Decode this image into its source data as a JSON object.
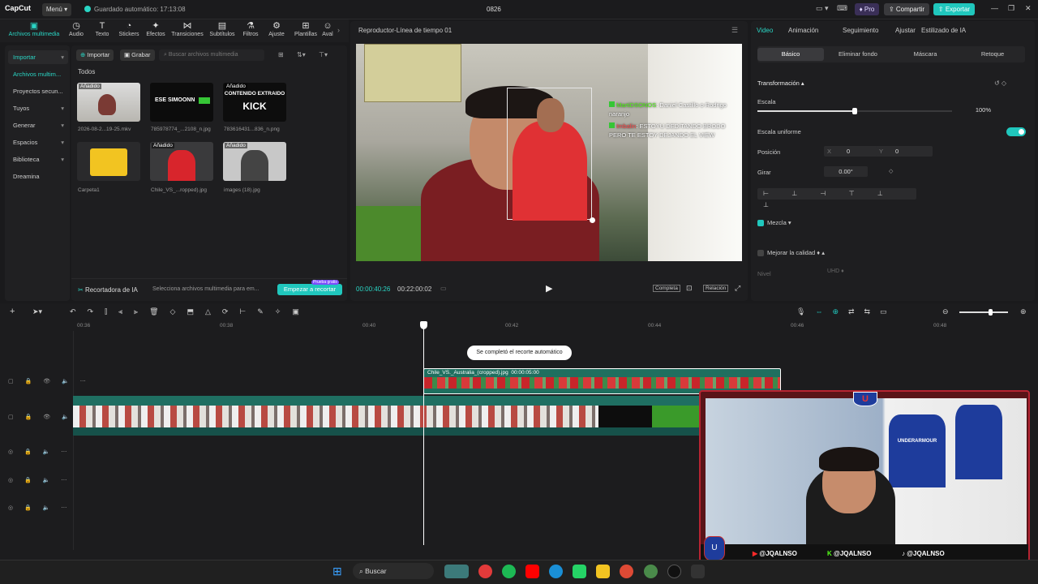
{
  "app": {
    "logo": "CapCut",
    "menu_label": "Menú",
    "autosave": "Guardado automático: 17:13:08",
    "project_title": "0826",
    "pro_label": "Pro",
    "share_label": "Compartir",
    "export_label": "Exportar"
  },
  "toolbar": [
    {
      "label": "Archivos multimedia",
      "icon": "media-icon"
    },
    {
      "label": "Audio",
      "icon": "audio-icon"
    },
    {
      "label": "Texto",
      "icon": "text-icon"
    },
    {
      "label": "Stickers",
      "icon": "sticker-icon"
    },
    {
      "label": "Efectos",
      "icon": "effects-icon"
    },
    {
      "label": "Transiciones",
      "icon": "transition-icon"
    },
    {
      "label": "Subtítulos",
      "icon": "subtitle-icon"
    },
    {
      "label": "Filtros",
      "icon": "filter-icon"
    },
    {
      "label": "Ajuste",
      "icon": "adjust-icon"
    },
    {
      "label": "Plantillas",
      "icon": "template-icon"
    },
    {
      "label": "Aval",
      "icon": "avatar-icon"
    }
  ],
  "leftnav": [
    {
      "label": "Importar"
    },
    {
      "label": "Archivos multim..."
    },
    {
      "label": "Proyectos secun..."
    },
    {
      "label": "Tuyos"
    },
    {
      "label": "Generar"
    },
    {
      "label": "Espacios"
    },
    {
      "label": "Biblioteca"
    },
    {
      "label": "Dreamina"
    }
  ],
  "media": {
    "import_label": "Importar",
    "record_label": "Grabar",
    "search_placeholder": "Buscar archivos multimedia",
    "section": "Todos",
    "added_tag": "Añadido",
    "items": [
      {
        "caption": "2026-08-2...19-25.mkv"
      },
      {
        "caption": "785978774_...2108_n.jpg",
        "title": "ESE SIMOONN"
      },
      {
        "caption": "783616431...836_n.png",
        "title": "CONTENIDO EXTRAIDO",
        "title2": "KICK"
      },
      {
        "caption": "Carpeta1"
      },
      {
        "caption": "Chile_VS_...ropped).jpg"
      },
      {
        "caption": "images (18).jpg"
      }
    ],
    "recorder_label": "Recortadora de IA",
    "recorder_hint": "Selecciona archivos multimedia para em...",
    "recorder_button": "Empezar a recortar",
    "recorder_badge": "Prueba gratis"
  },
  "player": {
    "title": "Reproductor-Línea de tiempo 01",
    "current_time": "00:00:40:26",
    "total_time": "00:22:00:02",
    "full_label": "Completa",
    "ratio_label": "Relación",
    "chat": [
      {
        "user": "MartiDSONOS",
        "message": ": Daniel Castillo o Rodrigo naranjo"
      },
      {
        "user": "Imbalin",
        "message": ": ESTOYU DEDITANDO BRODO PERO TE ESTOY DEJANDO EL VIEW"
      }
    ]
  },
  "props": {
    "tabs": [
      "Video",
      "Animación",
      "Seguimiento",
      "Ajustar",
      "Estilizado de IA"
    ],
    "subtabs": [
      "Básico",
      "Eliminar fondo",
      "Máscara",
      "Retoque"
    ],
    "transform_label": "Transformación",
    "scale_label": "Escala",
    "scale_value": "100%",
    "scale_level": 0.5,
    "uniform_label": "Escala uniforme",
    "position_label": "Posición",
    "pos_x_label": "X",
    "pos_x": "0",
    "pos_y_label": "Y",
    "pos_y": "0",
    "rotate_label": "Girar",
    "rotate_value": "0.00°",
    "blend_label": "Mezcla",
    "enhance_label": "Mejorar la calidad",
    "level_label": "Nivel",
    "level_value": "UHD"
  },
  "timeline": {
    "ticks": [
      "00:36",
      "00:38",
      "00:40",
      "00:42",
      "00:44",
      "00:46",
      "00:48"
    ],
    "toast": "Se completó el recorte automático",
    "clip_label": "Chile_VS._Australia_(cropped).jpg",
    "clip_duration": "00:00:05:00"
  },
  "overlay": {
    "handles": [
      "@JQALNSO",
      "@JQALNSO",
      "@JQALNSO"
    ],
    "jersey": "UNDERARMOUR"
  },
  "taskbar": {
    "search_label": "Buscar"
  }
}
